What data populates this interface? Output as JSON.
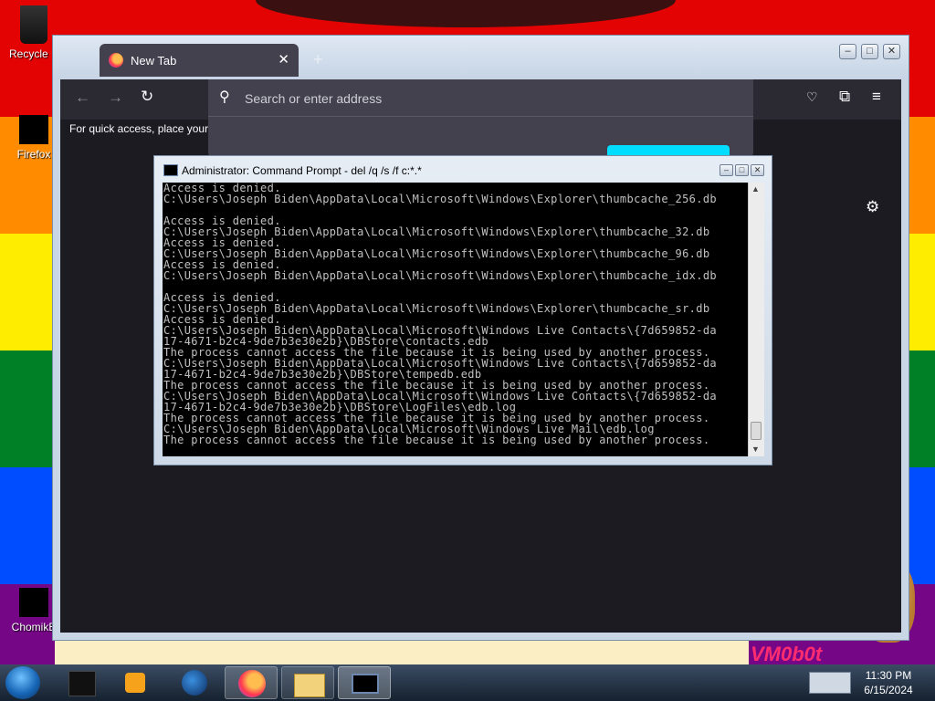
{
  "desktop": {
    "stripes": [
      "#e40303",
      "#ff8c00",
      "#ffed00",
      "#008026",
      "#004dff",
      "#750787"
    ],
    "icons": [
      {
        "label": "Recycle B",
        "name": "recycle-bin"
      },
      {
        "label": "Firefox",
        "name": "firefox"
      },
      {
        "label": "ChomikB",
        "name": "chomikbox"
      }
    ],
    "watermark": "VM0b0t"
  },
  "firefox": {
    "tab_title": "New Tab",
    "url_placeholder": "Search or enter address",
    "quick_access": "For quick access, place your b"
  },
  "cmd": {
    "title": "Administrator: Command Prompt - del  /q /s /f c:*.*",
    "lines": [
      "Access is denied.",
      "C:\\Users\\Joseph Biden\\AppData\\Local\\Microsoft\\Windows\\Explorer\\thumbcache_256.db",
      "",
      "Access is denied.",
      "C:\\Users\\Joseph Biden\\AppData\\Local\\Microsoft\\Windows\\Explorer\\thumbcache_32.db",
      "Access is denied.",
      "C:\\Users\\Joseph Biden\\AppData\\Local\\Microsoft\\Windows\\Explorer\\thumbcache_96.db",
      "Access is denied.",
      "C:\\Users\\Joseph Biden\\AppData\\Local\\Microsoft\\Windows\\Explorer\\thumbcache_idx.db",
      "",
      "Access is denied.",
      "C:\\Users\\Joseph Biden\\AppData\\Local\\Microsoft\\Windows\\Explorer\\thumbcache_sr.db",
      "Access is denied.",
      "C:\\Users\\Joseph Biden\\AppData\\Local\\Microsoft\\Windows Live Contacts\\{7d659852-da",
      "17-4671-b2c4-9de7b3e30e2b}\\DBStore\\contacts.edb",
      "The process cannot access the file because it is being used by another process.",
      "C:\\Users\\Joseph Biden\\AppData\\Local\\Microsoft\\Windows Live Contacts\\{7d659852-da",
      "17-4671-b2c4-9de7b3e30e2b}\\DBStore\\tempedb.edb",
      "The process cannot access the file because it is being used by another process.",
      "C:\\Users\\Joseph Biden\\AppData\\Local\\Microsoft\\Windows Live Contacts\\{7d659852-da",
      "17-4671-b2c4-9de7b3e30e2b}\\DBStore\\LogFiles\\edb.log",
      "The process cannot access the file because it is being used by another process.",
      "C:\\Users\\Joseph Biden\\AppData\\Local\\Microsoft\\Windows Live Mail\\edb.log",
      "The process cannot access the file because it is being used by another process.",
      "_"
    ]
  },
  "taskbar": {
    "clock_time": "11:30 PM",
    "clock_date": "6/15/2024"
  }
}
